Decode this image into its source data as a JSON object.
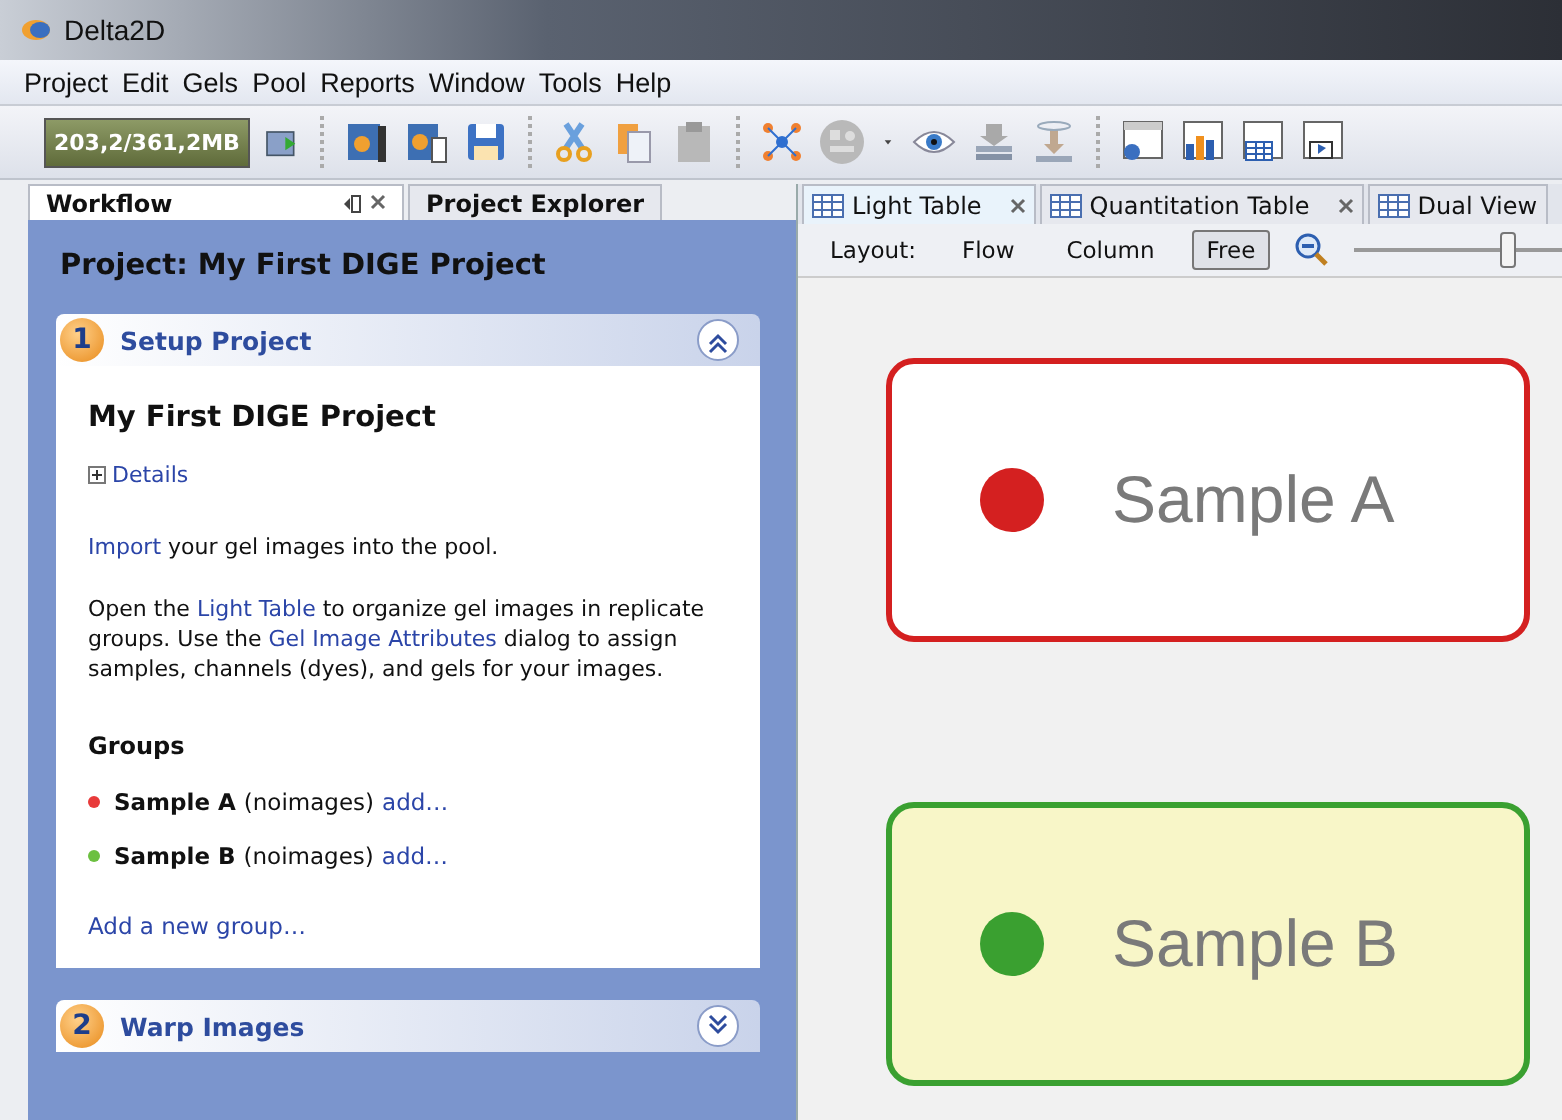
{
  "window": {
    "title": "Delta2D"
  },
  "menu": [
    "Project",
    "Edit",
    "Gels",
    "Pool",
    "Reports",
    "Window",
    "Tools",
    "Help"
  ],
  "toolbar": {
    "memory": "203,2/361,2MB"
  },
  "left_tabs": [
    {
      "label": "Workflow",
      "selected": true
    },
    {
      "label": "Project Explorer",
      "selected": false
    }
  ],
  "workflow": {
    "project_title": "Project: My First DIGE Project",
    "steps": [
      {
        "number": "1",
        "title": "Setup Project",
        "expanded": true,
        "heading": "My First DIGE Project",
        "details": "Details",
        "paragraphs": [
          [
            {
              "kind": "link",
              "text": "Import"
            },
            {
              "kind": "text",
              "text": " your gel images into the pool."
            }
          ],
          [
            {
              "kind": "text",
              "text": "Open the "
            },
            {
              "kind": "link",
              "text": "Light Table"
            },
            {
              "kind": "text",
              "text": " to organize gel images in replicate groups. Use the "
            },
            {
              "kind": "link",
              "text": "Gel Image Attributes"
            },
            {
              "kind": "text",
              "text": " dialog to assign samples, channels (dyes), and gels for your images."
            }
          ]
        ],
        "groups_heading": "Groups",
        "groups": [
          {
            "name": "Sample A",
            "note": "(noimages)",
            "action": "add…",
            "color": "#e83a3a"
          },
          {
            "name": "Sample B",
            "note": "(noimages)",
            "action": "add…",
            "color": "#6cc040"
          }
        ],
        "add_group": "Add a new group…"
      },
      {
        "number": "2",
        "title": "Warp Images",
        "expanded": false
      }
    ]
  },
  "right_tabs": [
    {
      "label": "Light Table",
      "selected": true
    },
    {
      "label": "Quantitation Table",
      "selected": false
    },
    {
      "label": "Dual View",
      "selected": false
    }
  ],
  "layout_bar": {
    "label": "Layout:",
    "options": [
      {
        "label": "Flow",
        "selected": false
      },
      {
        "label": "Column",
        "selected": false
      },
      {
        "label": "Free",
        "selected": true
      }
    ],
    "zoom": {
      "level": 0.74
    }
  },
  "canvas": {
    "samples": [
      {
        "name": "Sample A",
        "color": "#d42020",
        "selected": false
      },
      {
        "name": "Sample B",
        "color": "#3aa030",
        "selected": true
      }
    ]
  }
}
